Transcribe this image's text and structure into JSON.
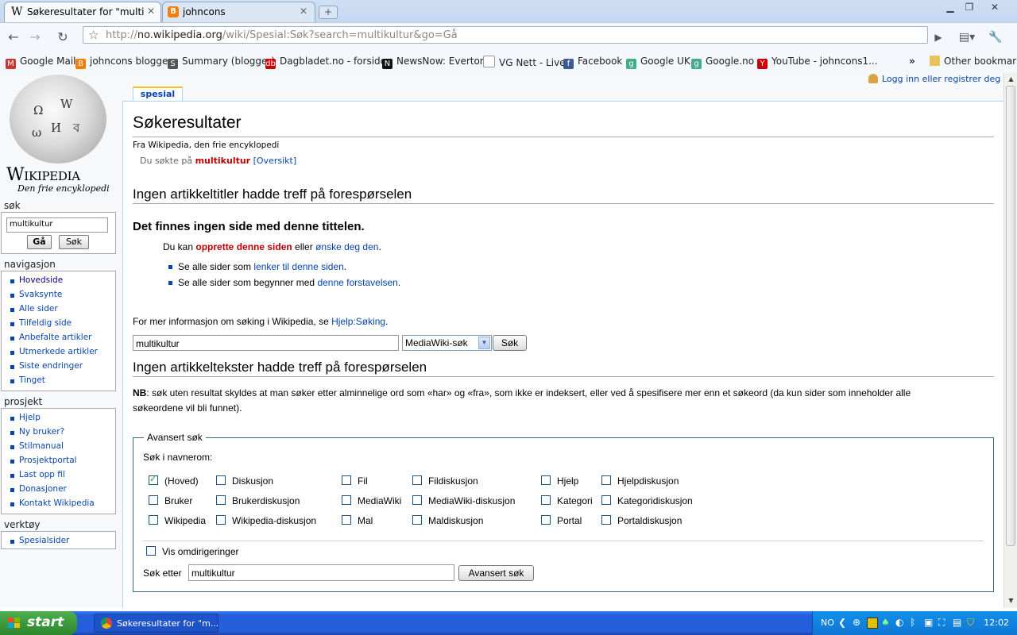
{
  "browser": {
    "tabs": [
      {
        "title": "Søkeresultater for \"multikul...",
        "favicon": "wikipedia-w"
      },
      {
        "title": "johncons",
        "favicon": "blogger"
      }
    ],
    "url_prefix": "http://",
    "url_host": "no.wikipedia.org",
    "url_rest": "/wiki/Spesial:Søk?search=multikultur&go=Gå",
    "bookmarks": [
      {
        "label": "Google Mail",
        "color": "#c33"
      },
      {
        "label": "johncons blogger",
        "color": "#f57d00"
      },
      {
        "label": "Summary (blogger)",
        "color": "#555"
      },
      {
        "label": "Dagbladet.no - forsiden",
        "color": "#c00"
      },
      {
        "label": "NewsNow: Everton",
        "color": "#111"
      },
      {
        "label": "VG Nett - Live!",
        "color": "#ddd"
      },
      {
        "label": "Facebook",
        "color": "#3b5998"
      },
      {
        "label": "Google UK",
        "color": "#4a8"
      },
      {
        "label": "Google.no",
        "color": "#4a8"
      },
      {
        "label": "YouTube - johncons1...",
        "color": "#c00"
      }
    ],
    "other_bookmarks": "Other bookmarks"
  },
  "wiki": {
    "logo_title": "Wikipedia",
    "logo_tagline": "Den frie encyklopedi",
    "login": "Logg inn eller registrer deg",
    "page_tab": "spesial",
    "sidebar": {
      "search_heading": "søk",
      "search_value": "multikultur",
      "go_button": "Gå",
      "search_button": "Søk",
      "nav_heading": "navigasjon",
      "nav": [
        "Hovedside",
        "Svaksynte",
        "Alle sider",
        "Tilfeldig side",
        "Anbefalte artikler",
        "Utmerkede artikler",
        "Siste endringer",
        "Tinget"
      ],
      "project_heading": "prosjekt",
      "project": [
        "Hjelp",
        "Ny bruker?",
        "Stilmanual",
        "Prosjektportal",
        "Last opp fil",
        "Donasjoner",
        "Kontakt Wikipedia"
      ],
      "tools_heading": "verktøy",
      "tools": [
        "Spesialsider"
      ]
    },
    "main": {
      "title": "Søkeresultater",
      "from": "Fra Wikipedia, den frie encyklopedi",
      "searched_prefix": "Du søkte på ",
      "searched_term": "multikultur",
      "overview": "[Oversikt]",
      "h2_titles": "Ingen artikkeltitler hadde treff på forespørselen",
      "no_page": "Det finnes ingen side med denne tittelen.",
      "can_prefix": "Du kan ",
      "create_link": "opprette denne siden",
      "or": " eller ",
      "wish_link": "ønske deg den",
      "dot": ".",
      "b1_prefix": "Se alle sider som ",
      "b1_link": "lenker til denne siden",
      "b2_prefix": "Se alle sider som begynner med ",
      "b2_link": "denne forstavelsen",
      "more_info": "For mer informasjon om søking i Wikipedia, se ",
      "help_link": "Hjelp:Søking",
      "search_value": "multikultur",
      "select_value": "MediaWiki-søk",
      "search_button": "Søk",
      "h2_texts": "Ingen artikkeltekster hadde treff på forespørselen",
      "nb_bold": "NB",
      "nb_line1": ": søk uten resultat skyldes at man søker etter alminnelige ord som «har» og «fra», som ikke er indeksert, eller ved å spesifisere mer enn et søkeord (da kun sider som inneholder alle",
      "nb_line2": "søkeordene vil bli funnet).",
      "advanced": {
        "legend": "Avansert søk",
        "namespaces_label": "Søk i navnerom:",
        "namespaces": [
          {
            "label": "(Hoved)",
            "checked": true
          },
          {
            "label": "Diskusjon",
            "checked": false
          },
          {
            "label": "Fil",
            "checked": false
          },
          {
            "label": "Fildiskusjon",
            "checked": false
          },
          {
            "label": "Hjelp",
            "checked": false
          },
          {
            "label": "Hjelpdiskusjon",
            "checked": false
          },
          {
            "label": "Bruker",
            "checked": false
          },
          {
            "label": "Brukerdiskusjon",
            "checked": false
          },
          {
            "label": "MediaWiki",
            "checked": false
          },
          {
            "label": "MediaWiki-diskusjon",
            "checked": false
          },
          {
            "label": "Kategori",
            "checked": false
          },
          {
            "label": "Kategoridiskusjon",
            "checked": false
          },
          {
            "label": "Wikipedia",
            "checked": false
          },
          {
            "label": "Wikipedia-diskusjon",
            "checked": false
          },
          {
            "label": "Mal",
            "checked": false
          },
          {
            "label": "Maldiskusjon",
            "checked": false
          },
          {
            "label": "Portal",
            "checked": false
          },
          {
            "label": "Portaldiskusjon",
            "checked": false
          }
        ],
        "redirects_label": "Vis omdirigeringer",
        "search_for_label": "Søk etter",
        "search_for_value": "multikultur",
        "button": "Avansert søk"
      }
    }
  },
  "taskbar": {
    "start": "start",
    "item": "Søkeresultater for \"m...",
    "lang": "NO",
    "clock": "12:02"
  }
}
